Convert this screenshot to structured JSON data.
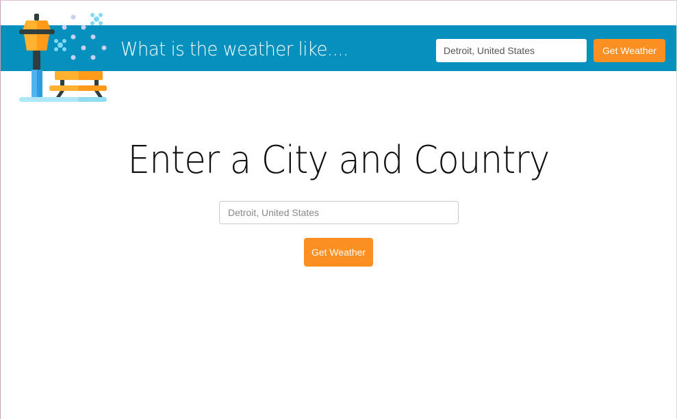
{
  "header": {
    "title": "What is the weather like....",
    "search": {
      "value": "",
      "placeholder": "Detroit, United States"
    },
    "button_label": "Get Weather"
  },
  "main": {
    "heading": "Enter a City and Country",
    "search": {
      "value": "",
      "placeholder": "Detroit, United States"
    },
    "button_label": "Get Weather"
  },
  "colors": {
    "header_bg": "#0590be",
    "accent": "#fb8f22",
    "text": "#111111"
  },
  "icons": {
    "logo": "winter-street-lamp-bench-icon"
  }
}
